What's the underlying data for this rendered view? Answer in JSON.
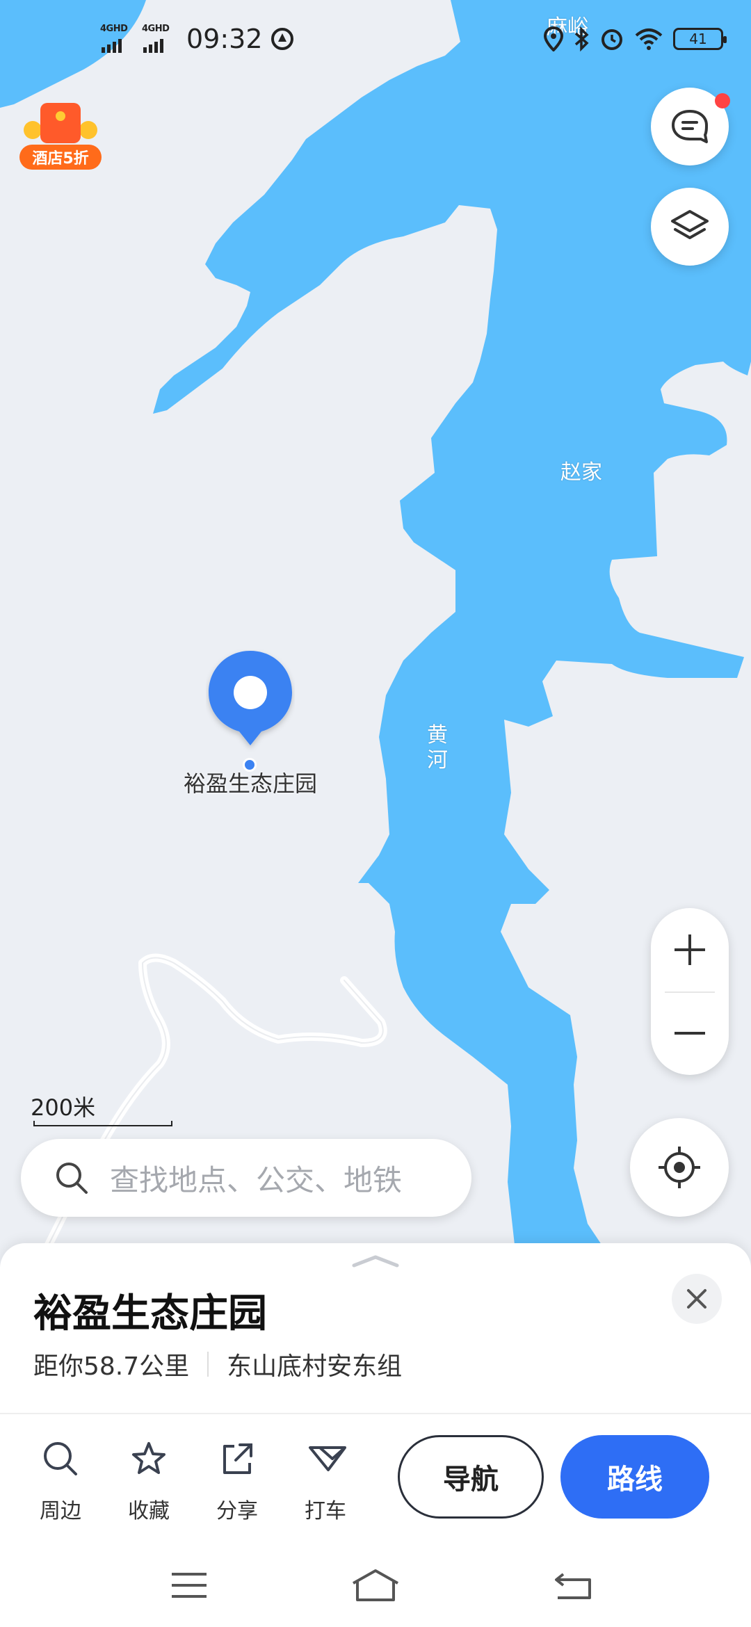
{
  "status_bar": {
    "signal1_tag": "4GHD",
    "signal2_tag": "4GHD",
    "time": "09:32",
    "battery": "41"
  },
  "promo": {
    "label": "酒店5折"
  },
  "map": {
    "labels": {
      "village_top": "麻峪",
      "village_right": "赵家",
      "river": "黄\n河"
    },
    "marker_name": "裕盈生态庄园",
    "scale_label": "200米",
    "water_color": "#5bbefc",
    "land_color": "#eceff4",
    "accent": "#2e6ef5"
  },
  "controls": {
    "message_icon": "chat-icon",
    "layers_icon": "layers-icon",
    "zoom_in_icon": "plus-icon",
    "zoom_out_icon": "minus-icon",
    "locate_icon": "crosshair-icon"
  },
  "search": {
    "placeholder": "查找地点、公交、地铁"
  },
  "place": {
    "title": "裕盈生态庄园",
    "distance": "距你58.7公里",
    "address": "东山底村安东组"
  },
  "actions": [
    {
      "label": "周边",
      "icon": "search-icon"
    },
    {
      "label": "收藏",
      "icon": "star-icon"
    },
    {
      "label": "分享",
      "icon": "share-icon"
    },
    {
      "label": "打车",
      "icon": "taxi-icon"
    }
  ],
  "buttons": {
    "navigate": "导航",
    "route": "路线"
  },
  "system_nav": {
    "menu_icon": "menu-icon",
    "home_icon": "home-icon",
    "back_icon": "back-icon"
  }
}
